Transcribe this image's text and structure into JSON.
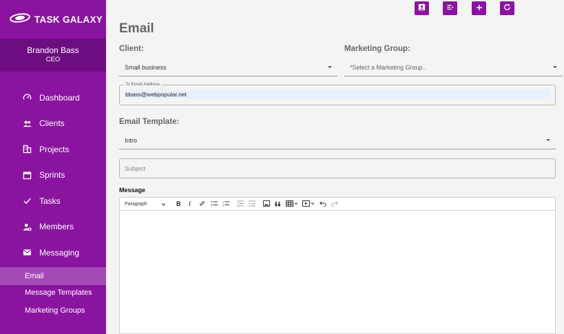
{
  "sidebar": {
    "brand": "TASK GALAXY",
    "user": {
      "name": "Brandon Bass",
      "role": "CEO"
    },
    "items": [
      {
        "label": "Dashboard",
        "icon": "speedometer-icon"
      },
      {
        "label": "Clients",
        "icon": "people-icon"
      },
      {
        "label": "Projects",
        "icon": "building-icon"
      },
      {
        "label": "Sprints",
        "icon": "calendar-icon"
      },
      {
        "label": "Tasks",
        "icon": "check-icon"
      },
      {
        "label": "Members",
        "icon": "person-settings-icon"
      },
      {
        "label": "Messaging",
        "icon": "mail-icon"
      }
    ],
    "subitems": [
      {
        "label": "Email",
        "active": true
      },
      {
        "label": "Message Templates",
        "active": false
      },
      {
        "label": "Marketing Groups",
        "active": false
      }
    ]
  },
  "header": {
    "actions": [
      "contact-card-icon",
      "list-send-icon",
      "plus-icon",
      "refresh-icon"
    ]
  },
  "main": {
    "title": "Email",
    "client": {
      "label": "Client:",
      "value": "Small business"
    },
    "marketing_group": {
      "label": "Marketing Group:",
      "placeholder": "*Select a Marketing Group.."
    },
    "to_email": {
      "legend": "To Email Address",
      "value": "bbass@webpopular.net"
    },
    "template": {
      "label": "Email Template:",
      "value": "Intro"
    },
    "subject": {
      "placeholder": "Subject"
    },
    "message": {
      "label": "Message",
      "toolbar": {
        "paragraph": "Paragraph",
        "buttons": [
          "bold-icon",
          "italic-icon",
          "link-icon",
          "bulleted-list-icon",
          "numbered-list-icon",
          "outdent-icon",
          "indent-icon",
          "image-icon",
          "blockquote-icon",
          "table-icon",
          "media-icon",
          "undo-icon",
          "redo-icon"
        ]
      }
    }
  },
  "colors": {
    "accent": "#8a14a0",
    "accent_dark": "#6e0d82",
    "active_sub": "#a64ab8"
  }
}
